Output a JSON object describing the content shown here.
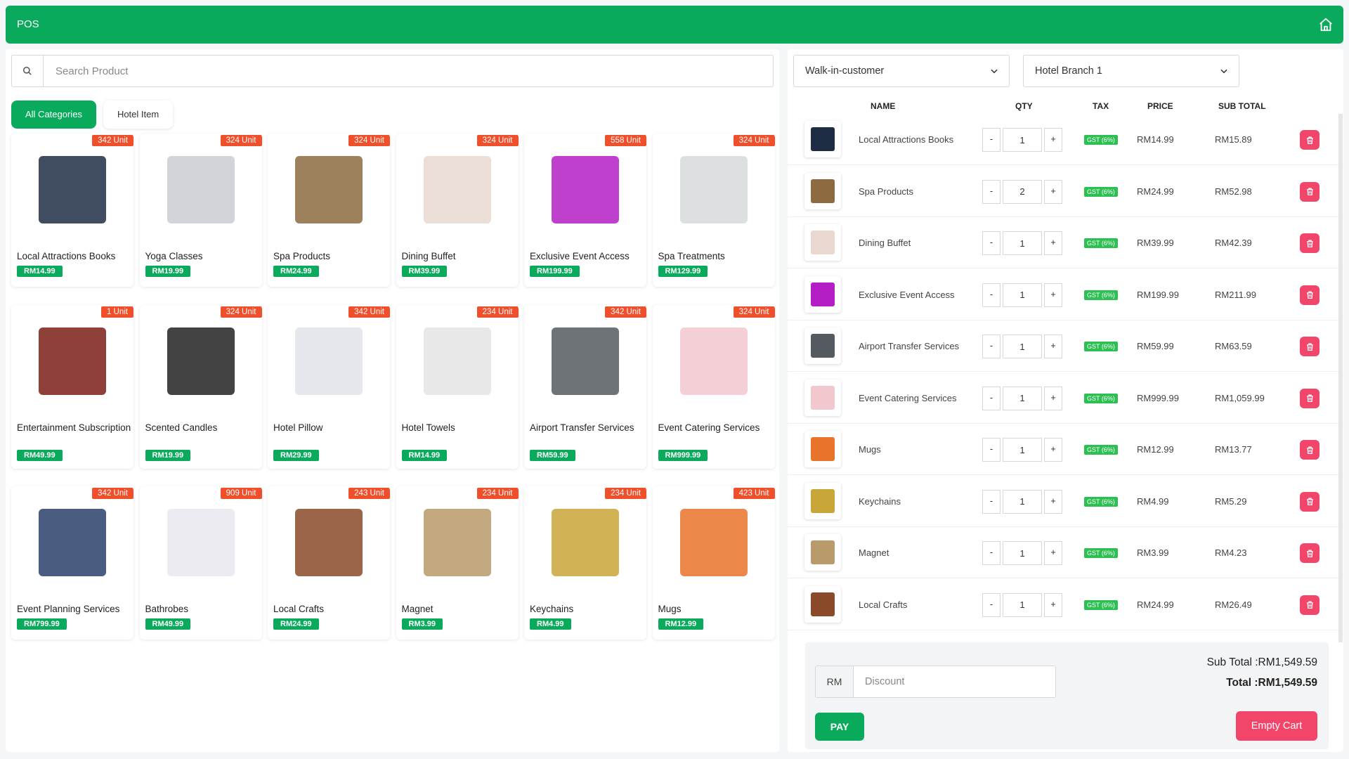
{
  "header": {
    "title": "POS",
    "home_icon": "home-icon"
  },
  "search": {
    "placeholder": "Search Product",
    "icon": "search-icon"
  },
  "categories": [
    {
      "label": "All Categories",
      "active": true
    },
    {
      "label": "Hotel Item",
      "active": false
    }
  ],
  "products": [
    {
      "name": "Local Attractions Books",
      "price": "RM14.99",
      "stock": "342 Unit",
      "color": "#1f2d44"
    },
    {
      "name": "Yoga Classes",
      "price": "RM19.99",
      "stock": "324 Unit",
      "color": "#c9ccd1"
    },
    {
      "name": "Spa Products",
      "price": "RM24.99",
      "stock": "324 Unit",
      "color": "#8b6b3f"
    },
    {
      "name": "Dining Buffet",
      "price": "RM39.99",
      "stock": "324 Unit",
      "color": "#e8d8d0"
    },
    {
      "name": "Exclusive Event Access",
      "price": "RM199.99",
      "stock": "558 Unit",
      "color": "#b31fc4"
    },
    {
      "name": "Spa Treatments",
      "price": "RM129.99",
      "stock": "324 Unit",
      "color": "#d7dbdc"
    },
    {
      "name": "Entertainment Subscription",
      "price": "RM49.99",
      "stock": "1 Unit",
      "color": "#7a1e16"
    },
    {
      "name": "Scented Candles",
      "price": "RM19.99",
      "stock": "324 Unit",
      "color": "#222222"
    },
    {
      "name": "Hotel Pillow",
      "price": "RM29.99",
      "stock": "342 Unit",
      "color": "#dfe3e8"
    },
    {
      "name": "Hotel Towels",
      "price": "RM14.99",
      "stock": "234 Unit",
      "color": "#e4e4e4"
    },
    {
      "name": "Airport Transfer Services",
      "price": "RM59.99",
      "stock": "342 Unit",
      "color": "#555a60"
    },
    {
      "name": "Event Catering Services",
      "price": "RM999.99",
      "stock": "324 Unit",
      "color": "#f2c8cf"
    },
    {
      "name": "Event Planning Services",
      "price": "RM799.99",
      "stock": "342 Unit",
      "color": "#2b3f6b"
    },
    {
      "name": "Bathrobes",
      "price": "RM49.99",
      "stock": "909 Unit",
      "color": "#e8e8ee"
    },
    {
      "name": "Local Crafts",
      "price": "RM24.99",
      "stock": "243 Unit",
      "color": "#8a4a2a"
    },
    {
      "name": "Magnet",
      "price": "RM3.99",
      "stock": "234 Unit",
      "color": "#b99a6a"
    },
    {
      "name": "Keychains",
      "price": "RM4.99",
      "stock": "234 Unit",
      "color": "#c9a638"
    },
    {
      "name": "Mugs",
      "price": "RM12.99",
      "stock": "423 Unit",
      "color": "#e8732a"
    }
  ],
  "cart": {
    "customer": "Walk-in-customer",
    "branch": "Hotel Branch 1",
    "columns": {
      "name": "NAME",
      "qty": "QTY",
      "tax": "TAX",
      "price": "PRICE",
      "subtotal": "SUB TOTAL"
    },
    "minus": "-",
    "plus": "+",
    "items": [
      {
        "name": "Local Attractions Books",
        "qty": "1",
        "tax": "GST (6%)",
        "price": "RM14.99",
        "subtotal": "RM15.89",
        "color": "#1f2d44"
      },
      {
        "name": "Spa Products",
        "qty": "2",
        "tax": "GST (6%)",
        "price": "RM24.99",
        "subtotal": "RM52.98",
        "color": "#8b6b3f"
      },
      {
        "name": "Dining Buffet",
        "qty": "1",
        "tax": "GST (6%)",
        "price": "RM39.99",
        "subtotal": "RM42.39",
        "color": "#e8d8d0"
      },
      {
        "name": "Exclusive Event Access",
        "qty": "1",
        "tax": "GST (6%)",
        "price": "RM199.99",
        "subtotal": "RM211.99",
        "color": "#b31fc4"
      },
      {
        "name": "Airport Transfer Services",
        "qty": "1",
        "tax": "GST (6%)",
        "price": "RM59.99",
        "subtotal": "RM63.59",
        "color": "#555a60"
      },
      {
        "name": "Event Catering Services",
        "qty": "1",
        "tax": "GST (6%)",
        "price": "RM999.99",
        "subtotal": "RM1,059.99",
        "color": "#f2c8cf"
      },
      {
        "name": "Mugs",
        "qty": "1",
        "tax": "GST (6%)",
        "price": "RM12.99",
        "subtotal": "RM13.77",
        "color": "#e8732a"
      },
      {
        "name": "Keychains",
        "qty": "1",
        "tax": "GST (6%)",
        "price": "RM4.99",
        "subtotal": "RM5.29",
        "color": "#c9a638"
      },
      {
        "name": "Magnet",
        "qty": "1",
        "tax": "GST (6%)",
        "price": "RM3.99",
        "subtotal": "RM4.23",
        "color": "#b99a6a"
      },
      {
        "name": "Local Crafts",
        "qty": "1",
        "tax": "GST (6%)",
        "price": "RM24.99",
        "subtotal": "RM26.49",
        "color": "#8a4a2a"
      }
    ],
    "currency_prefix": "RM",
    "discount_placeholder": "Discount",
    "sub_total": "Sub Total :RM1,549.59",
    "total": "Total :RM1,549.59",
    "pay_label": "PAY",
    "empty_label": "Empty Cart"
  },
  "colors": {
    "brand": "#0aaa5c",
    "badge": "#f04f2b",
    "danger": "#f2456a",
    "gst": "#2cbf51"
  }
}
